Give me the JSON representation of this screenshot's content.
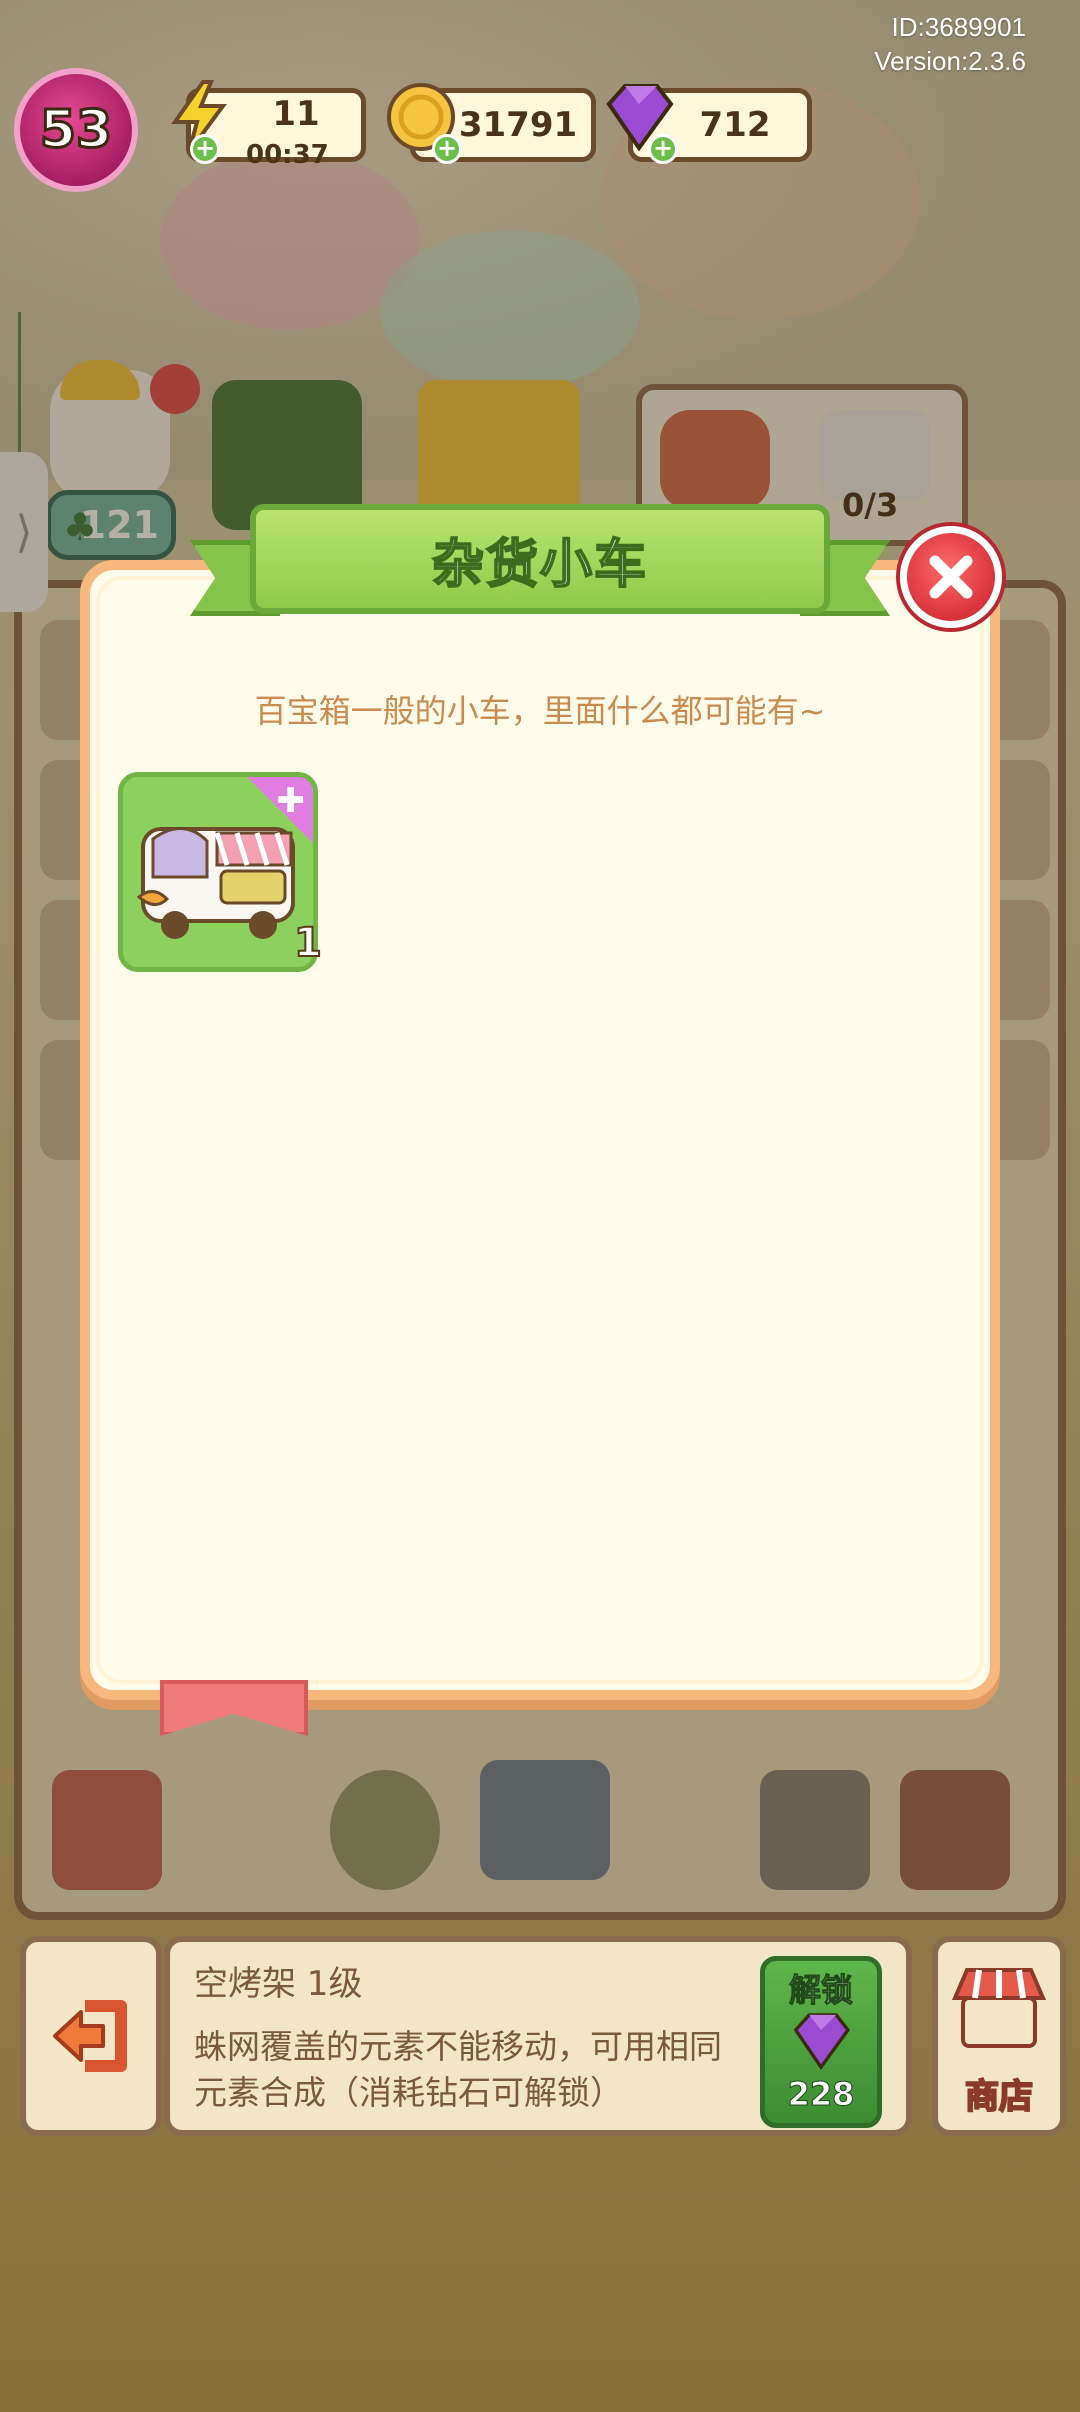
{
  "hud": {
    "player_id": "ID:3689901",
    "version": "Version:2.3.6",
    "level": "53",
    "energy": "11",
    "energy_timer": "00:37",
    "coins": "31791",
    "gems": "712",
    "clover_count": "121",
    "order_progress": "0/3"
  },
  "modal": {
    "title": "杂货小车",
    "description": "百宝箱一般的小车，里面什么都可能有~",
    "items": [
      {
        "name": "grocery-cart",
        "count": "1"
      }
    ]
  },
  "bottom": {
    "item_title": "空烤架 1级",
    "item_desc": "蛛网覆盖的元素不能移动，可用相同元素合成（消耗钻石可解锁）",
    "unlock_label": "解锁",
    "unlock_cost": "228",
    "shop_label": "商店"
  },
  "colors": {
    "modal_bg": "#fffbea",
    "modal_border": "#f6b87c",
    "ribbon_green": "#8fcb4a",
    "close_red": "#d8323a",
    "desc_text": "#c98b4f",
    "item_bg": "#8cd15d"
  },
  "icons": {
    "energy": "lightning-icon",
    "coins": "coin-icon",
    "gems": "gem-icon",
    "close": "close-icon",
    "back": "exit-icon",
    "shop": "shop-icon"
  }
}
